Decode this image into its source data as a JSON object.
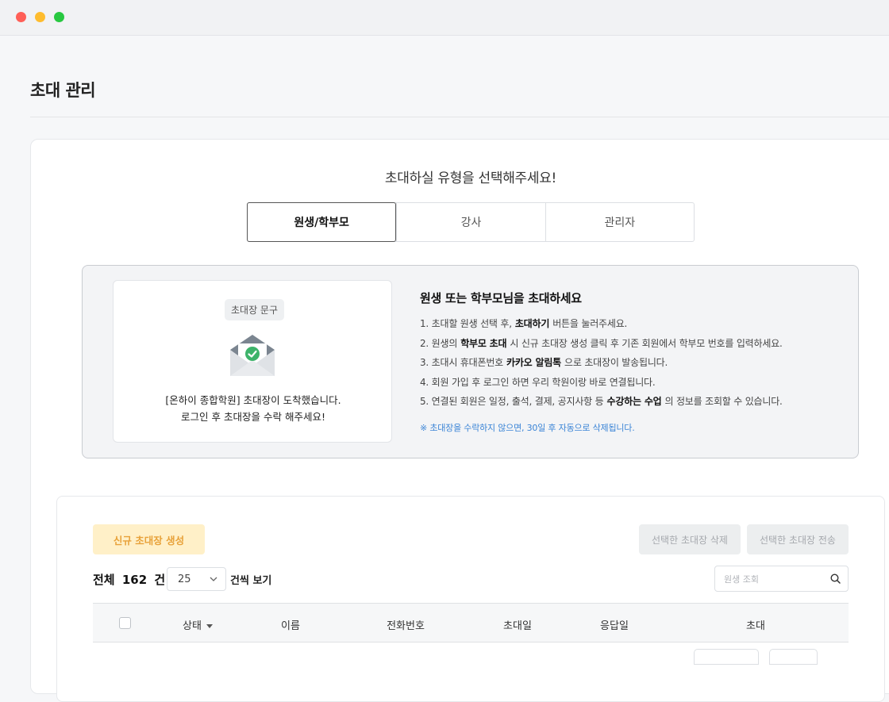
{
  "page": {
    "title": "초대 관리"
  },
  "invite": {
    "prompt": "초대하실 유형을 선택해주세요!",
    "tabs": [
      {
        "label": "원생/학부모",
        "active": true
      },
      {
        "label": "강사",
        "active": false
      },
      {
        "label": "관리자",
        "active": false
      }
    ]
  },
  "preview": {
    "chip": "초대장 문구",
    "line1": "[온하이 종합학원] 초대장이 도착했습니다.",
    "line2": "로그인 후 초대장을 수락 해주세요!"
  },
  "guide": {
    "title": "원생 또는 학부모님을 초대하세요",
    "lines": [
      {
        "pre": "1. 초대할 원생 선택 후,",
        "bold": "초대하기",
        "post": "버튼을 눌러주세요."
      },
      {
        "pre": "2. 원생의",
        "bold": "학부모 초대",
        "post": "시 신규 초대장 생성 클릭 후 기존 회원에서 학부모 번호를 입력하세요."
      },
      {
        "pre": "3. 초대시 휴대폰번호",
        "bold": "카카오 알림톡",
        "post": "으로 초대장이 발송됩니다."
      },
      {
        "pre": "4. 회원 가입 후 로그인 하면 우리 학원이랑 바로 연결됩니다.",
        "bold": "",
        "post": ""
      },
      {
        "pre": "5. 연결된 회원은 일정, 출석, 결제, 공지사항 등",
        "bold": "수강하는 수업",
        "post": "의 정보를 조회할 수 있습니다."
      }
    ],
    "note": "※ 초대장을 수락하지 않으면, 30일 후 자동으로 삭제됩니다."
  },
  "list": {
    "new_button": "신규 초대장 생성",
    "delete_button": "선택한 초대장 삭제",
    "send_button": "선택한 초대장 전송",
    "total_label": "전체",
    "total_count": "162",
    "total_unit": "건",
    "page_size": "25",
    "per_label": "건씩 보기",
    "search_placeholder": "원생 조회",
    "columns": {
      "status": "상태",
      "name": "이름",
      "phone": "전화번호",
      "invite_date": "초대일",
      "reply_date": "응답일",
      "invite": "초대"
    }
  },
  "colors": {
    "accent_button_bg": "#fff0c8",
    "accent_button_text": "#e8a23a",
    "note_blue": "#3a84d6",
    "envelope_gray": "#7b8590",
    "check_green": "#3db36a"
  }
}
